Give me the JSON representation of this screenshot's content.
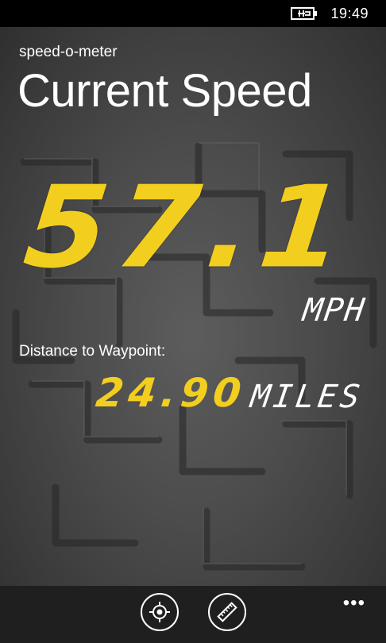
{
  "status_bar": {
    "time": "19:49",
    "battery_icon": "battery-charging-icon"
  },
  "app": {
    "name": "speed-o-meter",
    "page_title": "Current Speed"
  },
  "speed": {
    "value": "57.1",
    "unit": "MPH"
  },
  "distance": {
    "label": "Distance to Waypoint:",
    "value": "24.90",
    "unit": "MILES"
  },
  "app_bar": {
    "buttons": [
      {
        "icon": "locate-target-icon"
      },
      {
        "icon": "ruler-icon"
      }
    ],
    "more_icon": "more-dots-icon"
  },
  "colors": {
    "digits": "#f2cf1f",
    "background": "#4b4b4b",
    "appbar": "#1f1f1f"
  }
}
